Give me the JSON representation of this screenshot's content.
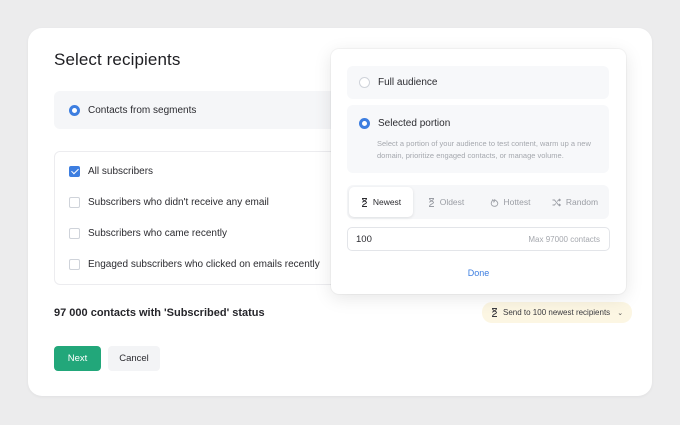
{
  "title": "Select recipients",
  "segments_option": {
    "label": "Contacts from segments",
    "selected": true
  },
  "subscriber_options": [
    {
      "label": "All subscribers",
      "checked": true
    },
    {
      "label": "Subscribers who didn't receive any email",
      "checked": false
    },
    {
      "label": "Subscribers who came recently",
      "checked": false
    },
    {
      "label": "Engaged subscribers who clicked on emails recently",
      "checked": false
    }
  ],
  "status_text": "97 000 contacts with 'Subscribed' status",
  "send_chip": {
    "label": "Send to 100 newest recipients",
    "icon": "hourglass-icon"
  },
  "buttons": {
    "next": "Next",
    "cancel": "Cancel"
  },
  "popover": {
    "full_audience": {
      "label": "Full audience",
      "selected": false
    },
    "selected_portion": {
      "label": "Selected portion",
      "selected": true,
      "description": "Select a portion of your audience to test content, warm up a new domain, prioritize engaged contacts, or manage volume."
    },
    "tabs": [
      {
        "label": "Newest",
        "icon": "hourglass-icon",
        "active": true
      },
      {
        "label": "Oldest",
        "icon": "hourglass-icon",
        "active": false
      },
      {
        "label": "Hottest",
        "icon": "flame-icon",
        "active": false
      },
      {
        "label": "Random",
        "icon": "shuffle-icon",
        "active": false
      }
    ],
    "count_input": {
      "value": "100",
      "max_hint": "Max 97000 contacts"
    },
    "done": "Done"
  },
  "colors": {
    "accent": "#3d7ee0",
    "primary_button": "#22a77a",
    "chip_bg": "#fcf6e3",
    "background": "#ececed"
  }
}
